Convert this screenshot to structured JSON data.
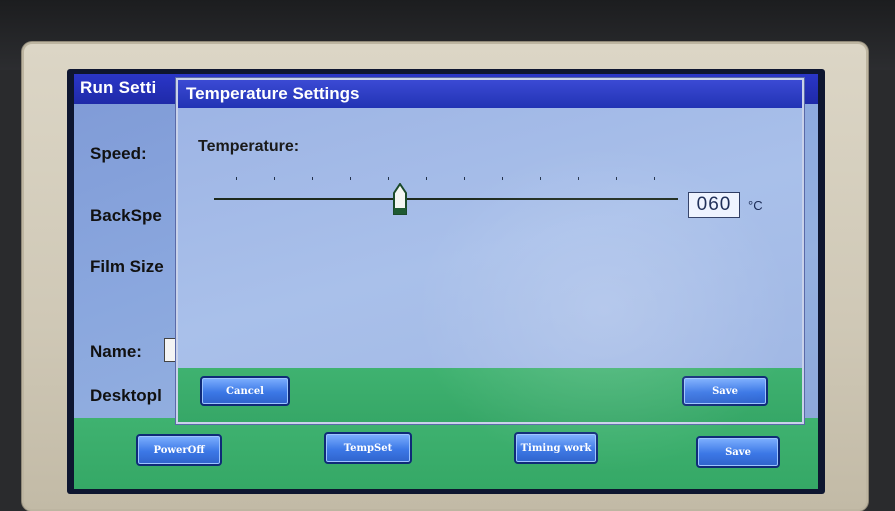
{
  "background_window": {
    "title": "Run Setti",
    "labels": {
      "speed": "Speed:",
      "backspeed": "BackSpe",
      "film_size": "Film Size",
      "name": "Name:",
      "desktop": "Desktopl"
    },
    "buttons": {
      "poweroff": "PowerOff",
      "tempset": "TempSet",
      "timing_work": "Timing work",
      "save": "Save"
    }
  },
  "dialog": {
    "title": "Temperature Settings",
    "temperature_label": "Temperature:",
    "slider_level_fraction": 0.4,
    "value": "060",
    "unit": "°C",
    "buttons": {
      "cancel": "Cancel",
      "save": "Save"
    }
  },
  "colors": {
    "title_bar": "#2233b4",
    "panel_green": "#3fb270",
    "lcd_button": "#3c78e6"
  }
}
